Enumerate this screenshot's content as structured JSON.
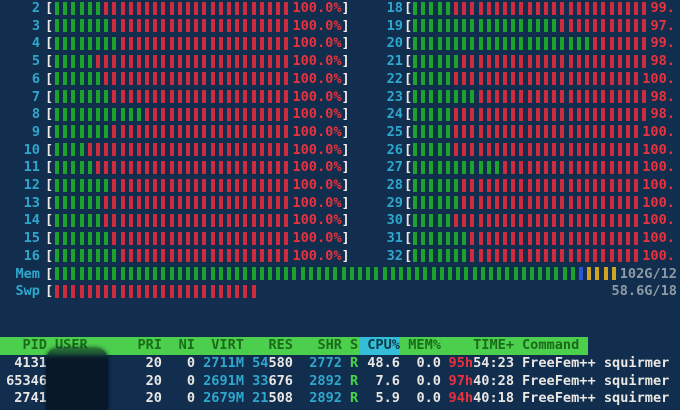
{
  "app": "htop",
  "colors": {
    "bg": "#112e4e",
    "pipe_green": "#1da32b",
    "pipe_red": "#cd2b3e",
    "pipe_blue": "#2e55d4",
    "pipe_yellow": "#d0a325",
    "text_cyan": "#2fa7cc",
    "text_red": "#e8323f",
    "text_white": "#e9e6e3",
    "text_gray": "#8f9aa5",
    "header_bg": "#4ccf4c",
    "header_text": "#1a6b1a",
    "sort_bg": "#35bcd8",
    "sort_text": "#073a46",
    "status_green": "#49d549",
    "bracket": "#efe9e6"
  },
  "brackets": {
    "open": "[",
    "close": "]"
  },
  "cpu_meters": {
    "left": [
      {
        "cpu": "2",
        "green": 6,
        "red": 23,
        "pct": "100.0%"
      },
      {
        "cpu": "3",
        "green": 7,
        "red": 22,
        "pct": "100.0%"
      },
      {
        "cpu": "4",
        "green": 8,
        "red": 21,
        "pct": "100.0%"
      },
      {
        "cpu": "5",
        "green": 5,
        "red": 24,
        "pct": "100.0%"
      },
      {
        "cpu": "6",
        "green": 6,
        "red": 23,
        "pct": "100.0%"
      },
      {
        "cpu": "7",
        "green": 7,
        "red": 22,
        "pct": "100.0%"
      },
      {
        "cpu": "8",
        "green": 11,
        "red": 18,
        "pct": "100.0%"
      },
      {
        "cpu": "9",
        "green": 7,
        "red": 22,
        "pct": "100.0%"
      },
      {
        "cpu": "10",
        "green": 4,
        "red": 25,
        "pct": "100.0%"
      },
      {
        "cpu": "11",
        "green": 5,
        "red": 24,
        "pct": "100.0%"
      },
      {
        "cpu": "12",
        "green": 7,
        "red": 22,
        "pct": "100.0%"
      },
      {
        "cpu": "13",
        "green": 6,
        "red": 23,
        "pct": "100.0%"
      },
      {
        "cpu": "14",
        "green": 6,
        "red": 23,
        "pct": "100.0%"
      },
      {
        "cpu": "15",
        "green": 7,
        "red": 22,
        "pct": "100.0%"
      },
      {
        "cpu": "16",
        "green": 8,
        "red": 21,
        "pct": "100.0%"
      }
    ],
    "right": [
      {
        "cpu": "18",
        "green": 5,
        "red": 24,
        "pct": "99."
      },
      {
        "cpu": "19",
        "green": 18,
        "red": 11,
        "pct": "97."
      },
      {
        "cpu": "20",
        "green": 22,
        "red": 7,
        "pct": "99."
      },
      {
        "cpu": "21",
        "green": 6,
        "red": 23,
        "pct": "98."
      },
      {
        "cpu": "22",
        "green": 5,
        "red": 23,
        "pct": "100."
      },
      {
        "cpu": "23",
        "green": 8,
        "red": 21,
        "pct": "98."
      },
      {
        "cpu": "24",
        "green": 5,
        "red": 24,
        "pct": "98."
      },
      {
        "cpu": "25",
        "green": 5,
        "red": 23,
        "pct": "100."
      },
      {
        "cpu": "26",
        "green": 5,
        "red": 23,
        "pct": "100."
      },
      {
        "cpu": "27",
        "green": 11,
        "red": 17,
        "pct": "100."
      },
      {
        "cpu": "28",
        "green": 6,
        "red": 22,
        "pct": "100."
      },
      {
        "cpu": "29",
        "green": 6,
        "red": 22,
        "pct": "100."
      },
      {
        "cpu": "30",
        "green": 5,
        "red": 23,
        "pct": "100."
      },
      {
        "cpu": "31",
        "green": 7,
        "red": 21,
        "pct": "100."
      },
      {
        "cpu": "32",
        "green": 7,
        "red": 21,
        "pct": "100."
      }
    ]
  },
  "memory_meter": {
    "label": "Mem",
    "green": 64,
    "blue": 1,
    "yellow": 4,
    "text": "102G/12"
  },
  "swap_meter": {
    "label": "Swp",
    "red": 25,
    "text": "58.6G/18"
  },
  "process_table": {
    "headers": [
      "PID",
      "USER",
      "PRI",
      "NI",
      "VIRT",
      "RES",
      "SHR",
      "S",
      "CPU%",
      "MEM%",
      "TIME+",
      "Command"
    ],
    "sort_column": "CPU%",
    "user_redacted": true,
    "rows": [
      {
        "pid": "4131",
        "user": "",
        "pri": "20",
        "ni": "0",
        "virt": "2711M",
        "res_mb": "54",
        "res_rest": "580",
        "shr": "2772",
        "state": "R",
        "cpu_pct": "48.6",
        "mem_pct": "0.0",
        "time_hours": "95h",
        "time_rest": "54:23",
        "command": "FreeFem++ squirmer"
      },
      {
        "pid": "65346",
        "user": "",
        "pri": "20",
        "ni": "0",
        "virt": "2691M",
        "res_mb": "33",
        "res_rest": "676",
        "shr": "2892",
        "state": "R",
        "cpu_pct": "7.6",
        "mem_pct": "0.0",
        "time_hours": "97h",
        "time_rest": "40:28",
        "command": "FreeFem++ squirmer"
      },
      {
        "pid": "2741",
        "user": "",
        "pri": "20",
        "ni": "0",
        "virt": "2679M",
        "res_mb": "21",
        "res_rest": "508",
        "shr": "2892",
        "state": "R",
        "cpu_pct": "5.9",
        "mem_pct": "0.0",
        "time_hours": "94h",
        "time_rest": "40:18",
        "command": "FreeFem++ squirmer"
      }
    ]
  }
}
